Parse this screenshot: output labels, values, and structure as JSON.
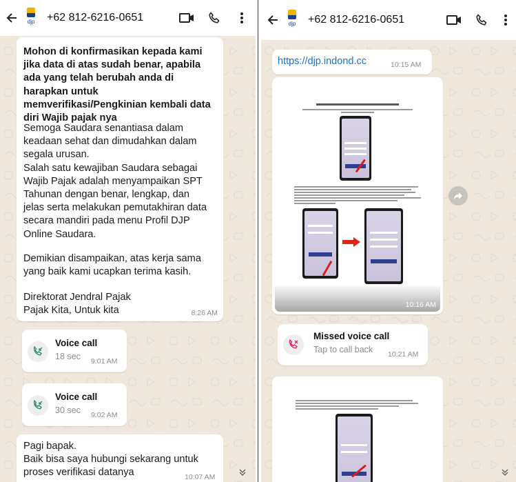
{
  "left": {
    "header": {
      "avatar_label": "djp",
      "phone": "+62 812-6216-0651"
    },
    "message1": {
      "bold_text": "Mohon di konfirmasikan kepada kami jika data di atas sudah benar, apabila ada yang telah berubah anda di harapkan untuk memverifikasi/Pengkinian kembali data diri Wajib pajak nya",
      "para1_lines": [
        "Semoga Saudara senantiasa dalam",
        "keadaan sehat dan dimudahkan dalam",
        "segala urusan.",
        "Salah satu kewajiban Saudara sebagai",
        "Wajib Pajak adalah menyampaikan SPT",
        "Tahunan dengan benar, lengkap, dan",
        "jelas serta melakukan pemutakhiran data",
        "secara mandiri pada menu Profil DJP",
        "Online Saudara."
      ],
      "para2_lines": [
        "Demikian disampaikan, atas kerja sama",
        "yang baik kami ucapkan terima kasih."
      ],
      "para3_lines": [
        "Direktorat Jendral Pajak",
        "Pajak Kita, Untuk kita"
      ],
      "time": "8:26 AM"
    },
    "call1": {
      "title": "Voice call",
      "duration": "18 sec",
      "time": "9:01 AM"
    },
    "call2": {
      "title": "Voice call",
      "duration": "30 sec",
      "time": "9:02 AM"
    },
    "message2": {
      "lines": [
        "Pagi bapak.",
        "Baik bisa saya hubungi sekarang untuk",
        "proses verifikasi datanya"
      ],
      "time": "10:07 AM"
    }
  },
  "right": {
    "header": {
      "avatar_label": "djp",
      "phone": "+62 812-6216-0651"
    },
    "link_message": {
      "url": "https://djp.indond.cc",
      "time": "10:15 AM"
    },
    "image_message": {
      "time": "10:16 AM"
    },
    "missed_call": {
      "title": "Missed voice call",
      "sub": "Tap to call back",
      "time": "10:21 AM"
    }
  },
  "colors": {
    "wallpaper": "#efe7dc",
    "bubble": "#ffffff",
    "link": "#1a73c9",
    "missed_call_red": "#e0245e",
    "timestamp": "#8c8c8c"
  },
  "icons": [
    "back-arrow-icon",
    "video-call-icon",
    "phone-icon",
    "more-vert-icon",
    "incoming-call-icon",
    "missed-call-icon",
    "forward-icon",
    "double-chevron-down-icon"
  ]
}
